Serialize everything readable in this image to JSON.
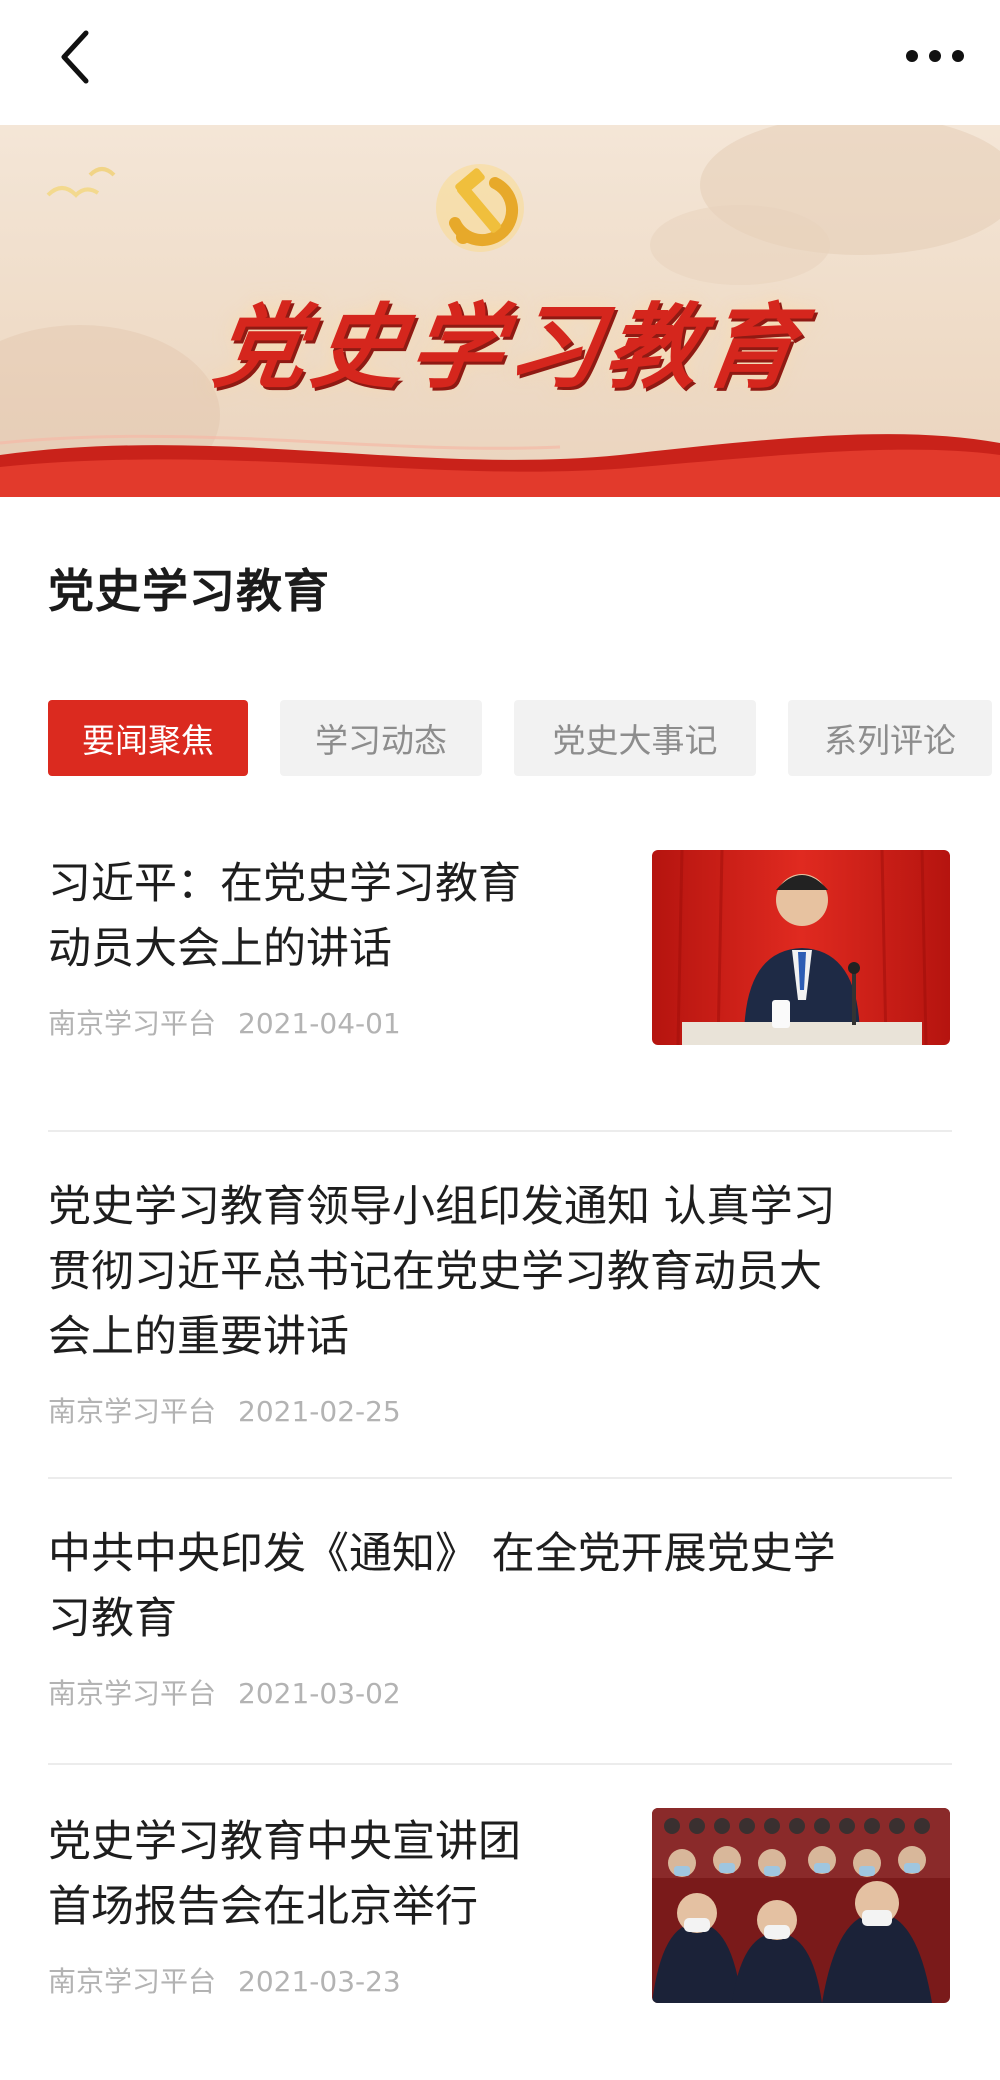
{
  "nav": {
    "back_icon": "chevron-left-icon",
    "more_icon": "more-horizontal-icon"
  },
  "banner": {
    "title": "党史学习教育",
    "emblem_icon": "hammer-sickle-icon"
  },
  "page_title": "党史学习教育",
  "tabs": [
    {
      "label": "要闻聚焦",
      "active": true
    },
    {
      "label": "学习动态",
      "active": false
    },
    {
      "label": "党史大事记",
      "active": false
    },
    {
      "label": "系列评论",
      "active": false
    }
  ],
  "articles": [
    {
      "title_lines": [
        "习近平：在党史学习教育",
        "动员大会上的讲话"
      ],
      "source": "南京学习平台",
      "date": "2021-04-01",
      "has_thumbnail": true
    },
    {
      "title_lines": [
        "党史学习教育领导小组印发通知 认真学习",
        "贯彻习近平总书记在党史学习教育动员大",
        "会上的重要讲话"
      ],
      "source": "南京学习平台",
      "date": "2021-02-25",
      "has_thumbnail": false
    },
    {
      "title_lines": [
        "中共中央印发《通知》 在全党开展党史学",
        "习教育"
      ],
      "source": "南京学习平台",
      "date": "2021-03-02",
      "has_thumbnail": false
    },
    {
      "title_lines": [
        "党史学习教育中央宣讲团",
        "首场报告会在北京举行"
      ],
      "source": "南京学习平台",
      "date": "2021-03-23",
      "has_thumbnail": true
    }
  ],
  "colors": {
    "accent": "#db2a1f",
    "tab_inactive_bg": "#f2f2f2",
    "meta_text": "#b3b3b3"
  }
}
